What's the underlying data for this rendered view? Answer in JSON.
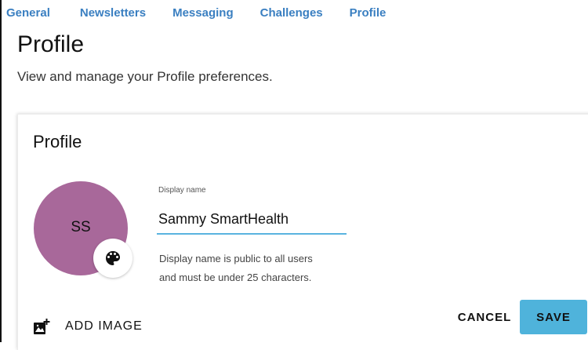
{
  "nav": {
    "tabs": [
      {
        "label": "General"
      },
      {
        "label": "Newsletters"
      },
      {
        "label": "Messaging"
      },
      {
        "label": "Challenges"
      },
      {
        "label": "Profile"
      }
    ]
  },
  "page": {
    "title": "Profile",
    "subtitle": "View and manage your Profile preferences."
  },
  "card": {
    "title": "Profile",
    "avatar": {
      "initials": "SS",
      "color": "#a8689a"
    },
    "display_name": {
      "label": "Display name",
      "value": "Sammy SmartHealth",
      "helper_line1": "Display name is public to all users",
      "helper_line2": "and must be under 25 characters."
    },
    "add_image_label": "ADD IMAGE",
    "cancel_label": "CANCEL",
    "save_label": "SAVE"
  },
  "colors": {
    "accent": "#4fb3db",
    "link": "#3a7fc1"
  },
  "icons": {
    "palette": "palette-icon",
    "add_image": "add-photo-icon"
  }
}
